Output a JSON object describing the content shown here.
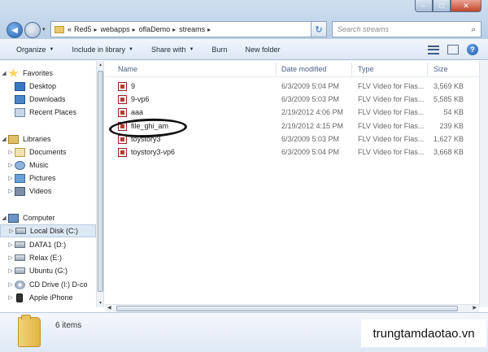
{
  "window": {
    "controls": {
      "minimize": "–",
      "maximize": "□",
      "close": "✕"
    }
  },
  "address": {
    "overflow": "«",
    "crumbs": [
      "Red5",
      "webapps",
      "oflaDemo",
      "streams"
    ],
    "separator": "▸"
  },
  "search": {
    "placeholder": "Search streams"
  },
  "toolbar": {
    "organize": "Organize",
    "include_in_library": "Include in library",
    "share_with": "Share with",
    "burn": "Burn",
    "new_folder": "New folder",
    "help": "?"
  },
  "nav": {
    "favorites": "Favorites",
    "desktop": "Desktop",
    "downloads": "Downloads",
    "recent_places": "Recent Places",
    "libraries": "Libraries",
    "documents": "Documents",
    "music": "Music",
    "pictures": "Pictures",
    "videos": "Videos",
    "computer": "Computer",
    "local_disk": "Local Disk (C:)",
    "data1": "DATA1 (D:)",
    "relax": "Relax (E:)",
    "ubuntu": "Ubuntu (G:)",
    "cd_drive": "CD Drive (I:) D-co",
    "apple_iphone": "Apple iPhone"
  },
  "columns": {
    "name": "Name",
    "date_modified": "Date modified",
    "type": "Type",
    "size": "Size"
  },
  "files": [
    {
      "name": "9",
      "date": "6/3/2009 5:04 PM",
      "type": "FLV Video for Flas...",
      "size": "3,569 KB"
    },
    {
      "name": "9-vp6",
      "date": "6/3/2009 5:03 PM",
      "type": "FLV Video for Flas...",
      "size": "5,585 KB"
    },
    {
      "name": "aaa",
      "date": "2/19/2012 4:06 PM",
      "type": "FLV Video for Flas...",
      "size": "54 KB"
    },
    {
      "name": "file_ghi_am",
      "date": "2/19/2012 4:15 PM",
      "type": "FLV Video for Flas...",
      "size": "239 KB"
    },
    {
      "name": "toystory3",
      "date": "6/3/2009 5:03 PM",
      "type": "FLV Video for Flas...",
      "size": "1,627 KB"
    },
    {
      "name": "toystory3-vp6",
      "date": "6/3/2009 5:04 PM",
      "type": "FLV Video for Flas...",
      "size": "3,668 KB"
    }
  ],
  "details": {
    "item_count": "6 items"
  },
  "watermark": "trungtamdaotao.vn"
}
